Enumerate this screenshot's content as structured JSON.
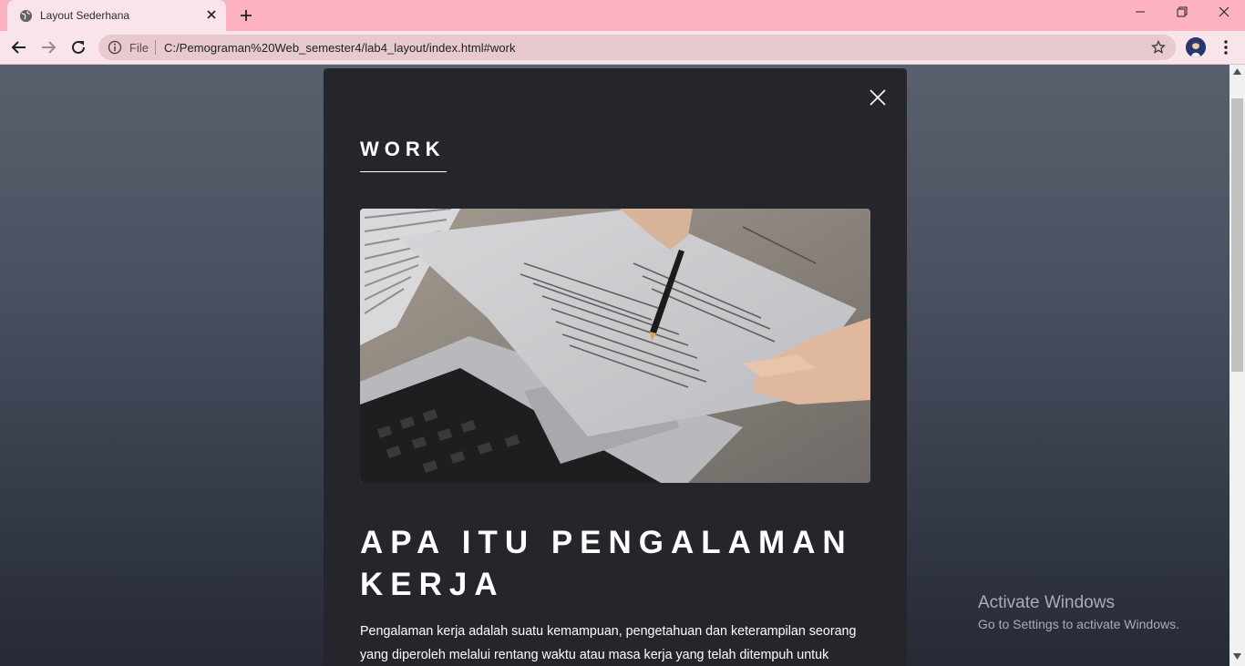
{
  "browser": {
    "tab_title": "Layout Sederhana",
    "omnibox_scheme": "File",
    "url": "C:/Pemograman%20Web_semester4/lab4_layout/index.html#work"
  },
  "article": {
    "section_title": "WORK",
    "heading": "APA ITU PENGALAMAN KERJA",
    "paragraph": "Pengalaman kerja adalah suatu kemampuan, pengetahuan dan keterampilan seorang yang diperoleh melalui rentang waktu atau masa kerja yang telah ditempuh untuk"
  },
  "watermark": {
    "title": "Activate Windows",
    "subtitle": "Go to Settings to activate Windows."
  },
  "colors": {
    "tabstrip": "#fcb2c1",
    "toolbar": "#f8e4e9",
    "article_bg": "#24262c"
  }
}
